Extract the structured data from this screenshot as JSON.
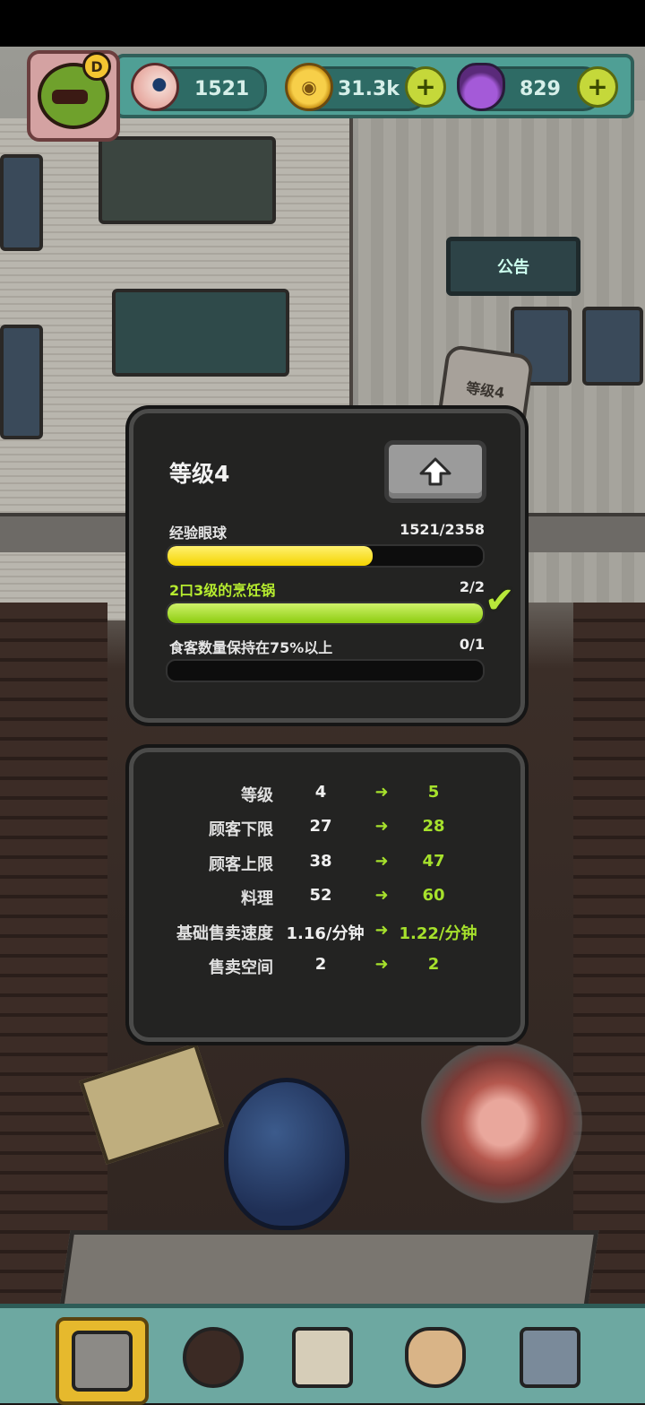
{
  "hud": {
    "avatar_badge": "D",
    "eyeballs": "1521",
    "coins": "31.3k",
    "potions": "829",
    "icons": [
      "eyeball-icon",
      "coin-icon",
      "potion-icon",
      "plus-icon"
    ]
  },
  "scene": {
    "notice_sign": "公告",
    "level_sign": "等级4"
  },
  "level_panel": {
    "title": "等级4",
    "upgrade_icon": "up-arrow-icon",
    "requirements": [
      {
        "label": "经验眼球",
        "value": "1521/2358",
        "progress": 0.65,
        "color": "#f4d400",
        "label_color": "#e6e6e6"
      },
      {
        "label": "2口3级的烹饪锅",
        "value": "2/2",
        "progress": 1.0,
        "color": "#8ccc10",
        "label_color": "#b6ec2f",
        "completed": true
      },
      {
        "label": "食客数量保持在75%以上",
        "value": "0/1",
        "progress": 0.0,
        "color": "#8ccc10",
        "label_color": "#e6e6e6"
      }
    ]
  },
  "stats": [
    {
      "name": "等级",
      "current": "4",
      "next": "5"
    },
    {
      "name": "顾客下限",
      "current": "27",
      "next": "28"
    },
    {
      "name": "顾客上限",
      "current": "38",
      "next": "47"
    },
    {
      "name": "料理",
      "current": "52",
      "next": "60"
    },
    {
      "name": "基础售卖速度",
      "current": "1.16/分钟",
      "next": "1.22/分钟"
    },
    {
      "name": "售卖空间",
      "current": "2",
      "next": "2"
    }
  ],
  "nav": {
    "items": [
      "restaurant-icon",
      "monster-icon",
      "recipe-book-icon",
      "money-bag-icon",
      "grid-menu-icon"
    ],
    "active": 0
  },
  "colors": {
    "accent_green": "#a6e12c",
    "hud_teal": "#4f9f95",
    "panel_bg": "#232322"
  }
}
